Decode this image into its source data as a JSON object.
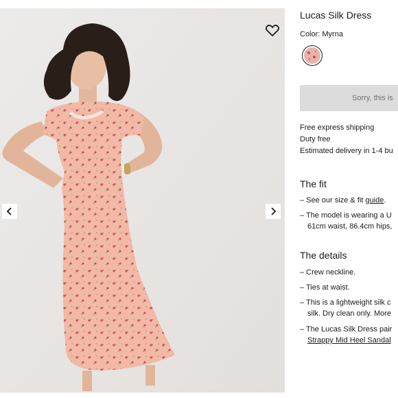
{
  "gallery": {
    "wishlist_icon": "heart-outline-icon",
    "prev_icon": "chevron-left-icon",
    "next_icon": "chevron-right-icon"
  },
  "product": {
    "title": "Lucas Silk Dress",
    "color_label": "Color: Myrna",
    "swatch_color": "#e8b4a8",
    "sold_out_text": "Sorry, this is"
  },
  "shipping": {
    "line1": "Free express shipping",
    "line2": "Duty free",
    "line3": "Estimated delivery in 1-4 bu"
  },
  "fit": {
    "heading": "The fit",
    "item1_prefix": "– See our size & fit ",
    "item1_link": "guide",
    "item1_suffix": ".",
    "item2_line1": "– The model is wearing a U",
    "item2_line2": "61cm waist, 86.4cm hips,"
  },
  "details": {
    "heading": "The details",
    "item1": "– Crew neckline.",
    "item2": "– Ties at waist.",
    "item3_line1": "– This is a lightweight silk c",
    "item3_line2": "silk. Dry clean only. More",
    "item4_line1": "– The Lucas Silk Dress pair",
    "item4_link": "Strappy Mid Heel Sandal"
  }
}
